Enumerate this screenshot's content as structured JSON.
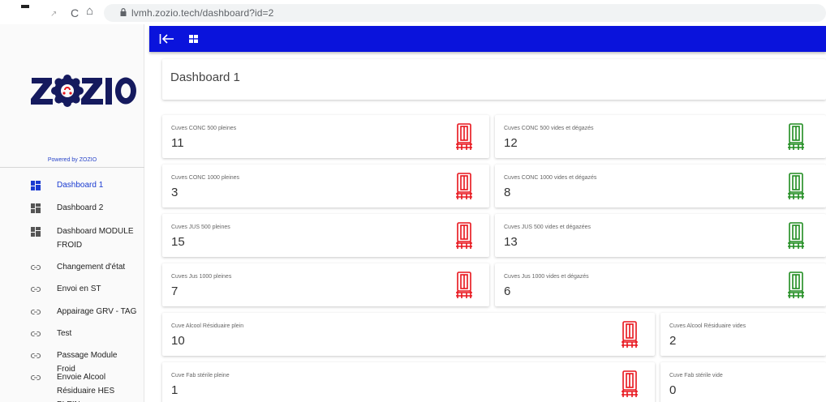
{
  "browser": {
    "back_glyph": "↗",
    "reload_glyph": "C",
    "home_glyph": "⌂",
    "url": "lvmh.zozio.tech/dashboard?id=2"
  },
  "sidebar": {
    "logo_text": "ZOZIO",
    "powered_by": "Powered by ZOZIO",
    "items": [
      {
        "label": "Dashboard 1",
        "icon": "dashboard-icon",
        "active": true
      },
      {
        "label": "Dashboard 2",
        "icon": "dashboard-icon"
      },
      {
        "label": "Dashboard MODULE FROID",
        "icon": "dashboard-icon"
      },
      {
        "label": "Changement d'état",
        "icon": "link-icon"
      },
      {
        "label": "Envoi en ST",
        "icon": "link-icon"
      },
      {
        "label": "Appairage GRV - TAG",
        "icon": "link-icon"
      },
      {
        "label": "Test",
        "icon": "link-icon"
      },
      {
        "label": "Passage Module Froid",
        "icon": "link-icon"
      },
      {
        "label": "Envoie Alcool Résiduaire HES PLEIN",
        "icon": "link-icon"
      }
    ]
  },
  "appbar": {
    "back_icon": "collapse-left-icon",
    "grid_icon": "grid-icon",
    "color": "#0a13dc"
  },
  "dashboard": {
    "title": "Dashboard 1",
    "colors": {
      "full": "#e8141b",
      "empty": "#1f8c1f"
    },
    "cards": [
      {
        "label": "Cuves CONC 500 pleines",
        "value": "11",
        "status": "full"
      },
      {
        "label": "Cuves CONC 500 vides et dégazés",
        "value": "12",
        "status": "empty"
      },
      {
        "label": "Cuves CONC 1000 pleines",
        "value": "3",
        "status": "full"
      },
      {
        "label": "Cuves CONC 1000 vides et dégazés",
        "value": "8",
        "status": "empty"
      },
      {
        "label": "Cuves JUS 500 pleines",
        "value": "15",
        "status": "full"
      },
      {
        "label": "Cuves JUS 500 vides et dégazées",
        "value": "13",
        "status": "empty"
      },
      {
        "label": "Cuves Jus 1000 pleines",
        "value": "7",
        "status": "full"
      },
      {
        "label": "Cuves Jus 1000 vides et dégazés",
        "value": "6",
        "status": "empty"
      },
      {
        "label": "Cuve Alcool Résiduaire plein",
        "value": "10",
        "status": "full"
      },
      {
        "label": "Cuves Alcool Résiduaire vides",
        "value": "2",
        "status": "empty"
      },
      {
        "label": "Cuve Fab stérile pleine",
        "value": "1",
        "status": "full"
      },
      {
        "label": "Cuve Fab stérile vide",
        "value": "0",
        "status": "empty"
      }
    ]
  }
}
